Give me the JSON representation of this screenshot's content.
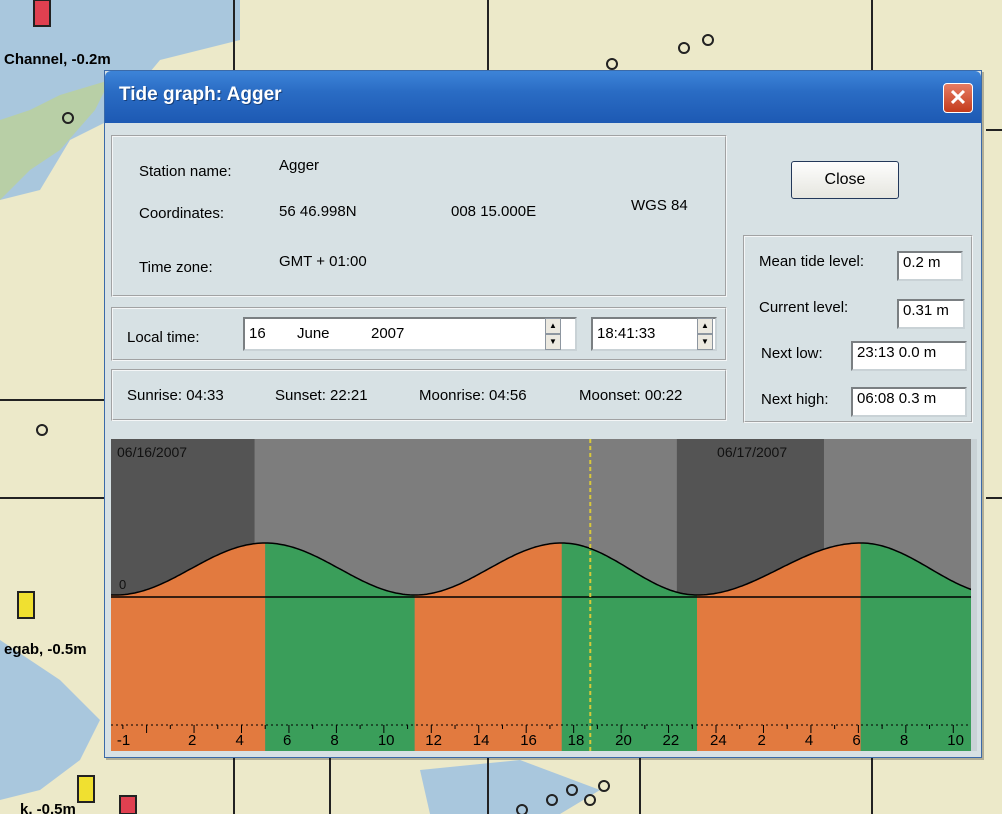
{
  "map": {
    "labels": [
      "Channel, -0.2m",
      "egab, -0.5m",
      "k, -0.5m"
    ]
  },
  "dialog": {
    "title": "Tide graph: Agger",
    "close_glyph": "✕",
    "station": {
      "name_label": "Station name:",
      "name_value": "Agger",
      "coord_label": "Coordinates:",
      "lat": "56 46.998N",
      "lon": "008 15.000E",
      "datum": "WGS 84",
      "tz_label": "Time zone:",
      "tz_value": "GMT + 01:00"
    },
    "local_time": {
      "label": "Local time:",
      "day": "16",
      "month": "June",
      "year": "2007",
      "time": "18:41:33"
    },
    "sun_moon": {
      "sunrise": "Sunrise: 04:33",
      "sunset": "Sunset: 22:21",
      "moonrise": "Moonrise: 04:56",
      "moonset": "Moonset: 00:22"
    },
    "close_button": "Close",
    "levels": {
      "mean_label": "Mean tide level:",
      "mean_value": "0.2 m",
      "current_label": "Current level:",
      "current_value": "0.31 m",
      "next_low_label": "Next low:",
      "next_low_value": "23:13  0.0 m",
      "next_high_label": "Next high:",
      "next_high_value": "06:08  0.3 m"
    }
  },
  "colors": {
    "rising": "#e27a3f",
    "falling": "#3a9e5a",
    "night": "#545454",
    "day": "#7d7d7d",
    "current_time_line": "#d8c83a"
  },
  "chart_data": {
    "type": "area",
    "date_labels": [
      "06/16/2007",
      "06/17/2007"
    ],
    "zero_label": "0",
    "hour_ticks": [
      "-1",
      "2",
      "4",
      "6",
      "8",
      "10",
      "12",
      "14",
      "16",
      "18",
      "20",
      "22",
      "24",
      "2",
      "4",
      "6",
      "8",
      "10"
    ],
    "x_range_hours": [
      -1.5,
      35
    ],
    "current_time_hours": 18.7,
    "night_periods": [
      [
        -1.5,
        4.55
      ],
      [
        22.35,
        28.55
      ]
    ],
    "high_waters": [
      {
        "t": 5.0,
        "level": 0.3
      },
      {
        "t": 17.5,
        "level": 0.3
      },
      {
        "t": 30.1,
        "level": 0.3
      }
    ],
    "low_waters": [
      {
        "t": -1.3,
        "level": 0.0
      },
      {
        "t": 11.3,
        "level": 0.0
      },
      {
        "t": 23.2,
        "level": 0.0
      },
      {
        "t": 36.0,
        "level": 0.0
      }
    ],
    "phases": [
      {
        "from": -1.5,
        "to": 5.0,
        "type": "rising"
      },
      {
        "from": 5.0,
        "to": 11.3,
        "type": "falling"
      },
      {
        "from": 11.3,
        "to": 17.5,
        "type": "rising"
      },
      {
        "from": 17.5,
        "to": 23.2,
        "type": "falling"
      },
      {
        "from": 23.2,
        "to": 30.1,
        "type": "rising"
      },
      {
        "from": 30.1,
        "to": 35.0,
        "type": "falling"
      }
    ]
  }
}
